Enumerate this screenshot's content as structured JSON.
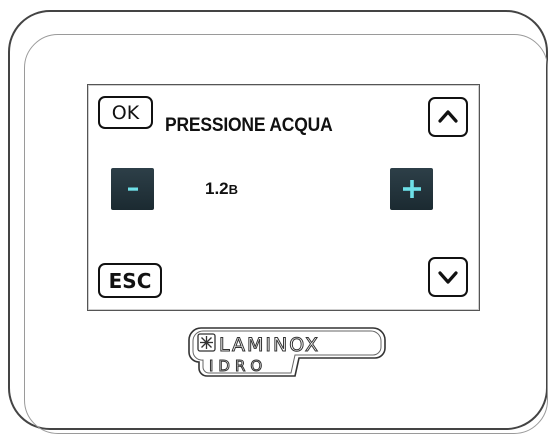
{
  "screen": {
    "title": "PRESSIONE ACQUA",
    "value": "1.2",
    "unit": "B",
    "ok_label": "OK",
    "esc_label": "ESC"
  },
  "icons": {
    "up": "chevron-up-icon",
    "down": "chevron-down-icon",
    "minus": "minus-icon",
    "plus": "plus-icon"
  },
  "colors": {
    "button_dark": "#24343c",
    "symbol_accent": "#6ee0e8"
  },
  "branding": {
    "brand": "LAMINOX",
    "sub_brand": "IDRO"
  }
}
